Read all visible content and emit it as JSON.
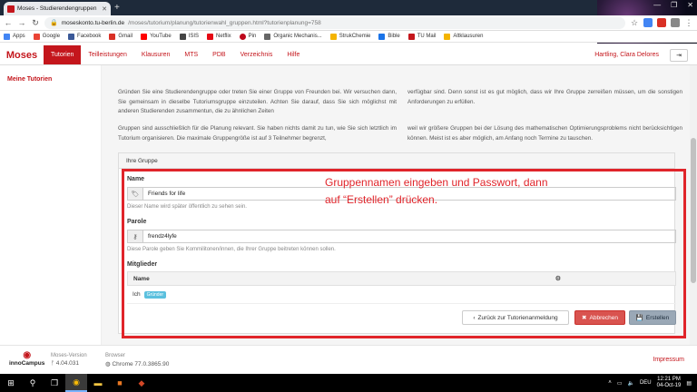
{
  "browser": {
    "tab_title": "Moses - Studierendengruppen",
    "tab_close": "✕",
    "new_tab": "+",
    "window_controls": [
      "—",
      "❐",
      "✕"
    ],
    "url_host": "moseskonto.tu-berlin.de",
    "url_path": "/moses/tutorium/planung/tutorienwahl_gruppen.html?tutorienplanung=758"
  },
  "bookmarks": [
    {
      "label": "Apps",
      "color": "#4285f4"
    },
    {
      "label": "Google",
      "color": "#ea4335"
    },
    {
      "label": "Facebook",
      "color": "#3b5998"
    },
    {
      "label": "Gmail",
      "color": "#d93025"
    },
    {
      "label": "YouTube",
      "color": "#ff0000"
    },
    {
      "label": "ISIS",
      "color": "#444444"
    },
    {
      "label": "Netflix",
      "color": "#e50914"
    },
    {
      "label": "Pin",
      "color": "#bd081c"
    },
    {
      "label": "Organic Mechanis...",
      "color": "#666666"
    },
    {
      "label": "StrukChemie",
      "color": "#f4b400"
    },
    {
      "label": "Bible",
      "color": "#1a73e8"
    },
    {
      "label": "TU Mail",
      "color": "#c4161c"
    },
    {
      "label": "Altklausuren",
      "color": "#f4b400"
    }
  ],
  "nav": {
    "logo": "Moses",
    "items": [
      "Tutorien",
      "Teilleistungen",
      "Klausuren",
      "MTS",
      "PDB",
      "Verzeichnis",
      "Hilfe"
    ],
    "user": "Hartling, Clara Delores"
  },
  "sidebar": {
    "item": "Meine Tutorien"
  },
  "intro": {
    "p1_left": "Gründen Sie eine Studierendengruppe oder treten Sie einer Gruppe von Freunden bei. Wir versuchen dann, Sie gemeinsam in dieselbe Tutoriumsgruppe einzuteilen. Achten Sie darauf, dass Sie sich möglichst mit anderen Studierenden zusammentun, die zu ähnlichen Zeiten",
    "p1_right": "verfügbar sind. Denn sonst ist es gut möglich, dass wir Ihre Gruppe zerreißen müssen, um die sonstigen Anforderungen zu erfüllen.",
    "p2_left": "Gruppen sind ausschließlich für die Planung relevant. Sie haben nichts damit zu tun, wie Sie sich letztlich im Tutorium organisieren. Die maximale Gruppengröße ist auf 3 Teilnehmer begrenzt,",
    "p2_right": "weil wir größere Gruppen bei der Lösung des mathematischen Optimierungsproblems nicht berücksichtigen können. Meist ist es aber möglich, am Anfang noch Termine zu tauschen."
  },
  "panel": {
    "title": "Ihre Gruppe",
    "name_label": "Name",
    "name_value": "Friends for life",
    "name_help": "Dieser Name wird später öffentlich zu sehen sein.",
    "parole_label": "Parole",
    "parole_value": "frendz4lyfe",
    "parole_help": "Diese Parole geben Sie Kommilitonen/innen, die Ihrer Gruppe beitreten können sollen.",
    "members_label": "Mitglieder",
    "col_name": "Name",
    "member_name": "Ich",
    "member_badge": "Gründer",
    "btn_back": "Zurück zur Tutorienanmeldung",
    "btn_cancel": "Abbrechen",
    "btn_create": "Erstellen"
  },
  "annotation": {
    "line1": "Gruppennamen eingeben und Passwort, dann",
    "line2": "auf “Erstellen” drücken."
  },
  "footer": {
    "logo_text": "innoCampus",
    "version_label": "Moses-Version",
    "version_value": "4.04.031",
    "browser_label": "Browser",
    "browser_value": "Chrome 77.0.3865.90",
    "impressum": "Impressum"
  },
  "taskbar": {
    "lang": "DEU",
    "time": "12:21 PM",
    "date": "04-Oct-19"
  }
}
